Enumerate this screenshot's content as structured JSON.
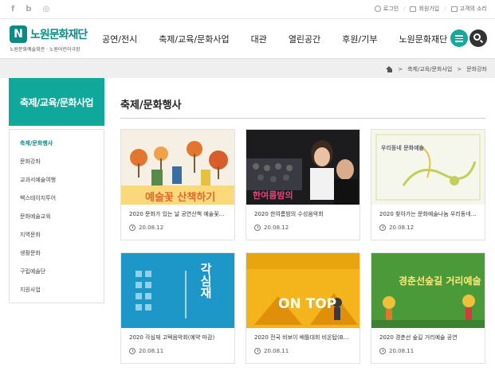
{
  "util": {
    "sns": [
      "f",
      "b",
      "◎"
    ],
    "links": [
      "로그인",
      "회원가입",
      "고객의 소리"
    ]
  },
  "logo": {
    "mark": "N",
    "name": "노원문화재단",
    "sub": "노원문화예술회관 · 노원어린이극장"
  },
  "gnb": [
    "공연/전시",
    "축제/교육/문화사업",
    "대관",
    "열린공간",
    "후원/기부",
    "노원문화재단"
  ],
  "breadcrumb": [
    "축제/교육/문화사업",
    "문화강좌"
  ],
  "sidebar": {
    "title": "축제/교육/문화사업",
    "items": [
      "축제/문화행사",
      "문화강좌",
      "교과서예술여행",
      "벡스테이지투어",
      "문화예술교육",
      "지역문화",
      "생활문화",
      "구립예술단",
      "지원사업"
    ]
  },
  "main": {
    "title": "축제/문화행사"
  },
  "cards": [
    {
      "title": "2020 문화가 있는 날 공연산책 예술꽃…",
      "date": "20.08.12",
      "thumb_text": "예술꽃 산책하기",
      "bg": "#f7f0e4",
      "accent": "#e0692e"
    },
    {
      "title": "2020 한여름밤의 수성음악회",
      "date": "20.08.12",
      "thumb_text": "한여름밤의",
      "bg": "#1e1e22",
      "accent": "#e8407a"
    },
    {
      "title": "2020 찾아가는 문화예술나눔 우리동네…",
      "date": "20.08.12",
      "thumb_text": "우리동네 문화예술",
      "bg": "#f5f7ea",
      "accent": "#c3cf5a"
    },
    {
      "title": "2020 각심재 고택음악회(예약 마감)",
      "date": "20.08.11",
      "thumb_text": "각심재",
      "bg": "#1d97c8",
      "accent": "#ffffff"
    },
    {
      "title": "2020 전국 비보이 배틀대회 비온탑(B…",
      "date": "20.08.11",
      "thumb_text": "ON TOP",
      "bg": "#f3b51b",
      "accent": "#ffffff"
    },
    {
      "title": "2020 경춘선 숲길 거리예술 공연",
      "date": "20.08.11",
      "thumb_text": "경춘선숲길 거리예술",
      "bg": "#4a9a3a",
      "accent": "#ffe97a"
    }
  ]
}
